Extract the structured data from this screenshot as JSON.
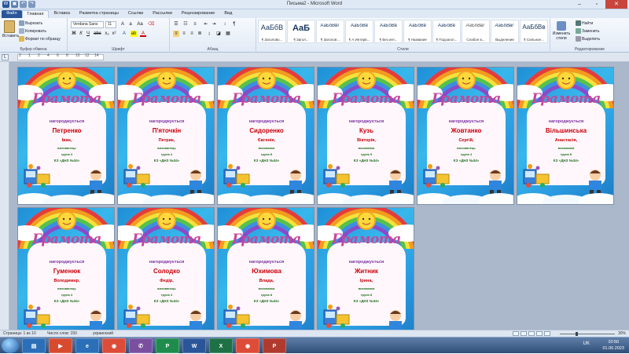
{
  "window": {
    "title": "Письма2 - Microsoft Word"
  },
  "tabs": [
    {
      "label": "Файл"
    },
    {
      "label": "Главная"
    },
    {
      "label": "Вставка"
    },
    {
      "label": "Разметка страницы"
    },
    {
      "label": "Ссылки"
    },
    {
      "label": "Рассылки"
    },
    {
      "label": "Рецензирование"
    },
    {
      "label": "Вид"
    }
  ],
  "ribbon": {
    "clipboard": {
      "paste": "Вставить",
      "cut": "Вырезать",
      "copy": "Копировать",
      "format_painter": "Формат по образцу",
      "label": "Буфер обмена"
    },
    "font": {
      "name": "Verdana Sans",
      "size": "11",
      "label": "Шрифт"
    },
    "paragraph": {
      "label": "Абзац"
    },
    "styles": {
      "label": "Стили",
      "items": [
        {
          "sample": "АаБбВ",
          "name": "¶ Заголово..."
        },
        {
          "sample": "АаБ",
          "name": "¶ Загол..."
        },
        {
          "sample": "АаБбВвГ",
          "name": "¶ Заголов..."
        },
        {
          "sample": "АаБбВв",
          "name": "¶ А Интерв..."
        },
        {
          "sample": "АаБбВв",
          "name": "¶ Без инт..."
        },
        {
          "sample": "АаБбВв",
          "name": "¶ Название"
        },
        {
          "sample": "АаБбВв",
          "name": "¶ Подзагол..."
        },
        {
          "sample": "АаБбВвГ",
          "name": "Слабое в..."
        },
        {
          "sample": "АаБбВвГ",
          "name": "Выделение"
        },
        {
          "sample": "АаБбВв",
          "name": "¶ Сильное..."
        }
      ],
      "change_styles": "Изменить стили"
    },
    "editing": {
      "find": "Найти",
      "replace": "Заменить",
      "select": "Выделить",
      "label": "Редактирование"
    }
  },
  "ruler": {
    "numbers": [
      "2",
      "1",
      "2",
      "4",
      "6",
      "8",
      "10",
      "12",
      "14"
    ]
  },
  "certificates": [
    {
      "title": "Грамота",
      "awarded": "нагороджується",
      "surname": "Петренко",
      "name": "Іван,",
      "pupil": "вихованець",
      "group": "група 4",
      "school": "КЗ «ДНЗ №34»"
    },
    {
      "title": "Грамота",
      "awarded": "нагороджується",
      "surname": "П'яточкін",
      "name": "Петрик,",
      "pupil": "вихованець",
      "group": "група 4",
      "school": "КЗ «ДНЗ №34»"
    },
    {
      "title": "Грамота",
      "awarded": "нагороджується",
      "surname": "Сидоренко",
      "name": "Євгенія,",
      "pupil": "вихованка",
      "group": "група 8",
      "school": "КЗ «ДНЗ №34»"
    },
    {
      "title": "Грамота",
      "awarded": "нагороджується",
      "surname": "Кузь",
      "name": "Вікторія,",
      "pupil": "вихованка",
      "group": "група 5",
      "school": "КЗ «ДНЗ №34»"
    },
    {
      "title": "Грамота",
      "awarded": "нагороджується",
      "surname": "Жовтанко",
      "name": "Сергій,",
      "pupil": "вихованець",
      "group": "група 4",
      "school": "КЗ «ДНЗ №34»"
    },
    {
      "title": "Грамота",
      "awarded": "нагороджується",
      "surname": "Вільшинська",
      "name": "Анастасія,",
      "pupil": "вихованка",
      "group": "група 8",
      "school": "КЗ «ДНЗ №34»"
    },
    {
      "title": "Грамота",
      "awarded": "нагороджується",
      "surname": "Гуменюк",
      "name": "Володимир,",
      "pupil": "вихованець",
      "group": "група 4",
      "school": "КЗ «ДНЗ №34»"
    },
    {
      "title": "Грамота",
      "awarded": "нагороджується",
      "surname": "Солодко",
      "name": "Федір,",
      "pupil": "вихованець",
      "group": "група 4",
      "school": "КЗ «ДНЗ №34»"
    },
    {
      "title": "Грамота",
      "awarded": "нагороджується",
      "surname": "Юхимова",
      "name": "Влада,",
      "pupil": "вихованка",
      "group": "група 8",
      "school": "КЗ «ДНЗ №34»"
    },
    {
      "title": "Грамота",
      "awarded": "нагороджується",
      "surname": "Житник",
      "name": "Ірина,",
      "pupil": "вихованка",
      "group": "група 8",
      "school": "КЗ «ДНЗ №34»"
    }
  ],
  "status": {
    "page": "Страница: 1 из 10",
    "words": "Число слов: 150",
    "language": "украинский",
    "zoom": "30%",
    "zoom_level": 0.3
  },
  "taskbar": {
    "lang": "UK",
    "time": "10:50",
    "date": "01.06.2023"
  }
}
